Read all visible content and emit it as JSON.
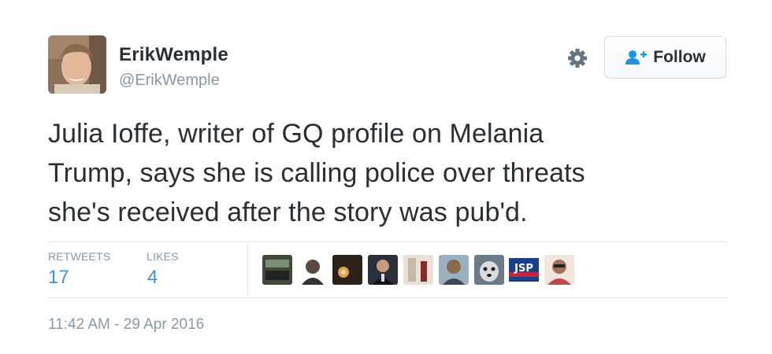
{
  "author": {
    "display_name": "ErikWemple",
    "handle": "@ErikWemple",
    "avatar_icon": "profile-photo"
  },
  "actions": {
    "settings_icon": "gear-icon",
    "follow_label": "Follow",
    "follow_icon": "add-user-icon"
  },
  "tweet": {
    "text": "Julia Ioffe, writer of GQ profile on Melania\nTrump, says she is calling police over threats\nshe's received after the story was pub'd."
  },
  "stats": {
    "retweets_label": "RETWEETS",
    "retweets_count": "17",
    "likes_label": "LIKES",
    "likes_count": "4"
  },
  "likers": [
    {
      "name": "liker-1",
      "color": "#3f4a3a"
    },
    {
      "name": "liker-2",
      "color": "#ffffff"
    },
    {
      "name": "liker-3",
      "color": "#2b2118"
    },
    {
      "name": "liker-4",
      "color": "#2a2f3a"
    },
    {
      "name": "liker-5",
      "color": "#c9b8a6"
    },
    {
      "name": "liker-6",
      "color": "#8a6a4f"
    },
    {
      "name": "liker-7",
      "color": "#6c7a86"
    },
    {
      "name": "liker-8",
      "color": "#c0283a"
    },
    {
      "name": "liker-9",
      "color": "#c04a4a"
    }
  ],
  "timestamp": "11:42 AM - 29 Apr 2016",
  "colors": {
    "text": "#292f33",
    "muted": "#8899a6",
    "link_blue": "#3b94d9",
    "follow_icon_blue": "#1b95e0",
    "divider": "#e1e8ed"
  }
}
